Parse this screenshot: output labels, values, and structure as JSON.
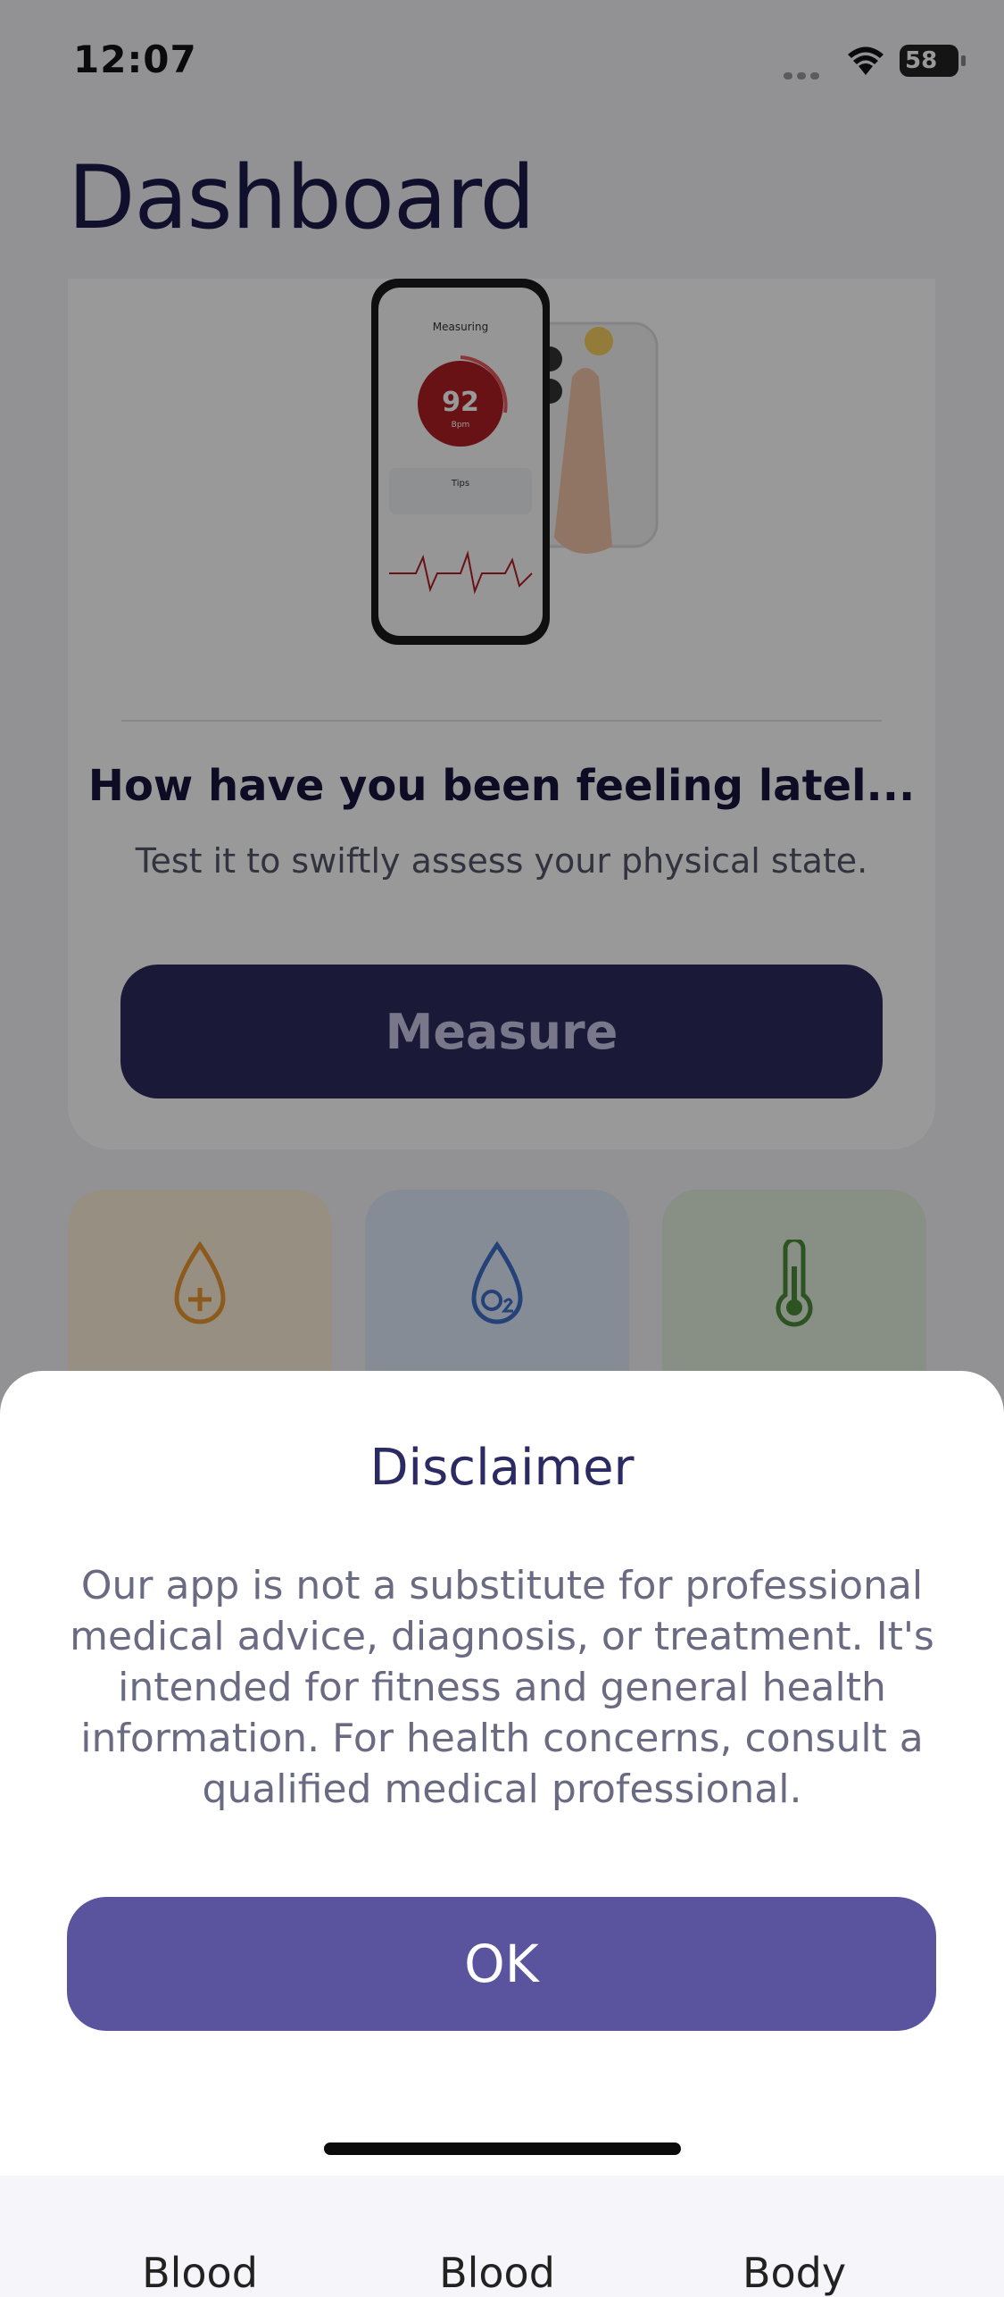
{
  "status_bar": {
    "time": "12:07",
    "battery": "58"
  },
  "page": {
    "title": "Dashboard"
  },
  "card": {
    "phone_mock": {
      "screen_title": "Measuring",
      "bpm_value": "92",
      "bpm_unit": "Bpm",
      "tips_label": "Tips"
    },
    "heading": "How have you been feeling latel...",
    "subtitle": "Test it to swiftly assess your physical state.",
    "button_label": "Measure"
  },
  "tiles": [
    {
      "label": "Blood",
      "icon": "blood-drop-plus-icon",
      "color": "#e8962f",
      "bg": "#fcefd9"
    },
    {
      "label": "Blood",
      "icon": "oxygen-drop-icon",
      "color": "#3d6fc9",
      "bg": "#dfe9f8"
    },
    {
      "label": "Body",
      "icon": "thermometer-icon",
      "color": "#4c8a3a",
      "bg": "#e3efdc"
    }
  ],
  "disclaimer": {
    "title": "Disclaimer",
    "body": "Our app is not a substitute for professional medical advice, diagnosis, or treatment. It's intended for fitness and general health information. For health concerns, consult a qualified medical professional.",
    "ok_label": "OK"
  }
}
